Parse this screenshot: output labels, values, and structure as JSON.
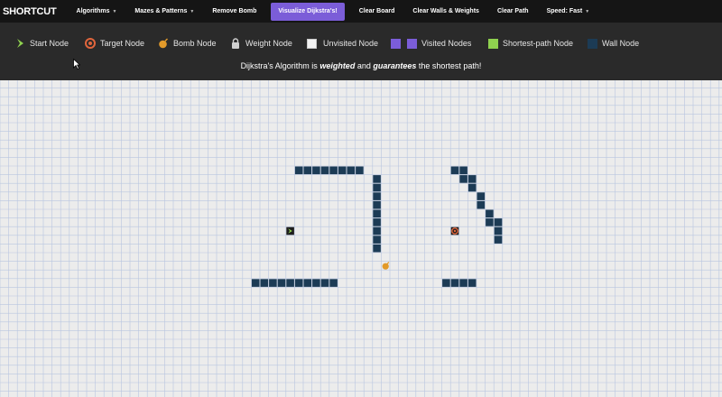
{
  "navbar": {
    "brand": "SHORTCUT",
    "algorithms": "Algorithms",
    "mazes": "Mazes & Patterns",
    "remove_bomb": "Remove Bomb",
    "visualize": "Visualize Dijkstra's!",
    "clear_board": "Clear Board",
    "clear_walls": "Clear Walls & Weights",
    "clear_path": "Clear Path",
    "speed": "Speed: Fast"
  },
  "legend": {
    "start": "Start Node",
    "target": "Target Node",
    "bomb": "Bomb Node",
    "weight": "Weight Node",
    "unvisited": "Unvisited Node",
    "visited": "Visited Nodes",
    "shortest": "Shortest-path Node",
    "wall": "Wall Node"
  },
  "description": {
    "pre": "Dijkstra's Algorithm is ",
    "weighted": "weighted",
    "mid": " and ",
    "guarantees": "guarantees",
    "post": " the shortest path!"
  },
  "colors": {
    "wall": "#1c3b55",
    "visited": "#7b5dd8",
    "shortest": "#8fd14f",
    "start_arrow": "#8fd14f",
    "target": "#e0653c",
    "bomb": "#e29a2a",
    "grid_line": "#b9c6e0"
  },
  "board": {
    "cols": 84,
    "rows": 37,
    "walls": [
      [
        34,
        10
      ],
      [
        35,
        10
      ],
      [
        36,
        10
      ],
      [
        37,
        10
      ],
      [
        38,
        10
      ],
      [
        39,
        10
      ],
      [
        40,
        10
      ],
      [
        41,
        10
      ],
      [
        43,
        11
      ],
      [
        43,
        12
      ],
      [
        43,
        13
      ],
      [
        43,
        14
      ],
      [
        43,
        15
      ],
      [
        43,
        16
      ],
      [
        43,
        17
      ],
      [
        43,
        18
      ],
      [
        43,
        19
      ],
      [
        29,
        23
      ],
      [
        30,
        23
      ],
      [
        31,
        23
      ],
      [
        32,
        23
      ],
      [
        33,
        23
      ],
      [
        34,
        23
      ],
      [
        35,
        23
      ],
      [
        36,
        23
      ],
      [
        37,
        23
      ],
      [
        38,
        23
      ],
      [
        52,
        10
      ],
      [
        53,
        10
      ],
      [
        53,
        11
      ],
      [
        54,
        11
      ],
      [
        54,
        12
      ],
      [
        55,
        13
      ],
      [
        55,
        14
      ],
      [
        56,
        15
      ],
      [
        56,
        16
      ],
      [
        57,
        16
      ],
      [
        57,
        17
      ],
      [
        57,
        18
      ],
      [
        51,
        23
      ],
      [
        52,
        23
      ],
      [
        53,
        23
      ],
      [
        54,
        23
      ]
    ],
    "start": [
      33,
      17
    ],
    "target": [
      52,
      17
    ],
    "bomb": [
      44,
      21
    ]
  }
}
